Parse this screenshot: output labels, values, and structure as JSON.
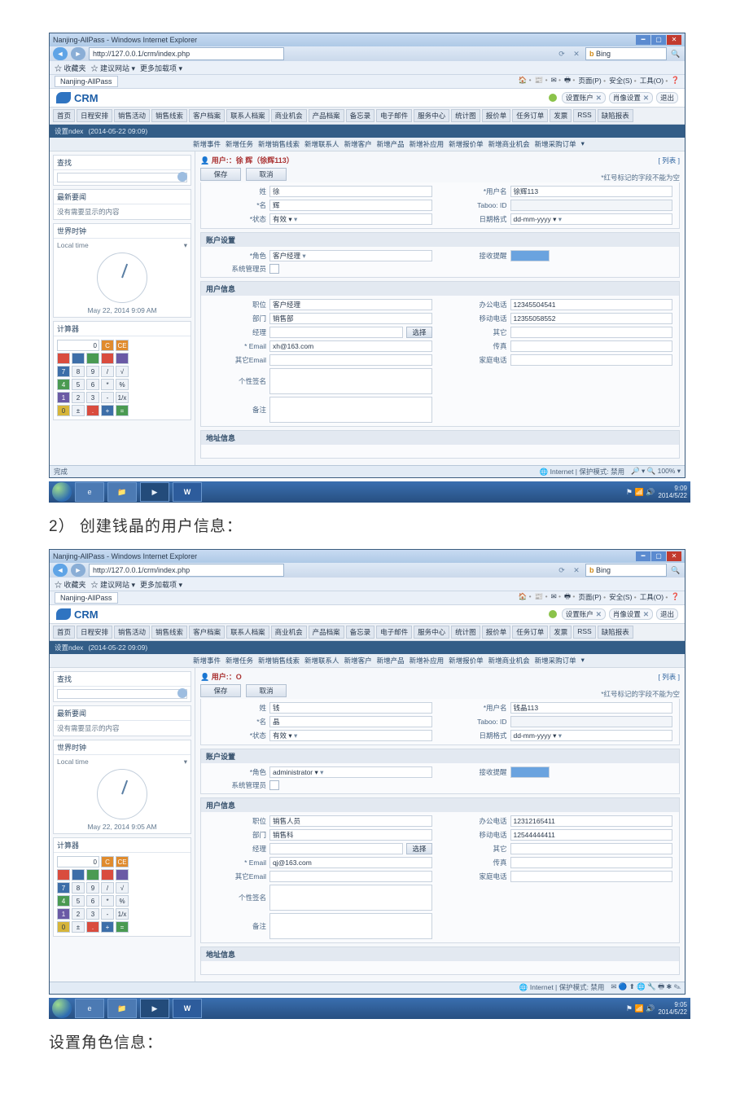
{
  "doc": {
    "caption_step2": "2） 创建钱晶的用户信息：",
    "caption_roles": "设置角色信息："
  },
  "chrome": {
    "tab_title": "Nanjing-AllPass - Windows Internet Explorer",
    "url": "http://127.0.0.1/crm/index.php",
    "search_engine": "Bing",
    "search_refresh": "⟳",
    "search_x": "✕",
    "search_glass": "🔍",
    "fav_star": "☆ 收藏夹",
    "fav_sugg": "☆ 建议网站 ▾",
    "fav_more": "更多加载项 ▾",
    "page_tab": "Nanjing-AllPass",
    "cmd_home": "🏠",
    "cmd_feed": "📰",
    "cmd_mail": "✉",
    "cmd_print": "🖶",
    "cmd_page": "页面(P)",
    "cmd_safe": "安全(S)",
    "cmd_tool": "工具(O)",
    "cmd_help": "❓",
    "status_done": "完成",
    "status_zone": "🌐 Internet | 保护模式: 禁用",
    "status_zoom": "🔎 ▾ 🔍 100% ▾"
  },
  "app": {
    "brand": "CRM",
    "hdr_set1": "设置账户",
    "hdr_set2": "肖像设置",
    "hdr_logout": "退出",
    "modules": [
      "首页",
      "日程安排",
      "销售活动",
      "销售线索",
      "客户档案",
      "联系人档案",
      "商业机会",
      "产品档案",
      "备忘录",
      "电子邮件",
      "服务中心",
      "统计图",
      "报价单",
      "任务订单",
      "发票",
      "RSS",
      "缺陷报表"
    ],
    "subnav_prefix": "设置ndex",
    "subnav_time": "(2014-05-22 09:09)",
    "sub_actions": [
      "新增事件",
      "新增任务",
      "新增销售线索",
      "新增联系人",
      "新增客户",
      "新增产品",
      "新增补应用",
      "新增报价单",
      "新增商业机会",
      "新增采购订单",
      "▾"
    ],
    "left_search_t": "查找",
    "left_news_t": "最新要闻",
    "left_news_b": "没有需要显示的内容",
    "left_clock_t": "世界时钟",
    "left_tz1": "Local time",
    "left_tz2": "▾",
    "left_calc_t": "计算器",
    "clock_date1": "May 22, 2014 9:09 AM",
    "clock_date2": "May 22, 2014 9:05 AM",
    "calc_lcd": "0",
    "save_btn": "保存",
    "cancel_btn": "取消",
    "select_btn": "选择",
    "more_link": "[ 列表 ]",
    "req_note": "*红号标记的字段不能为空",
    "panel_login": "账户设置",
    "panel_role_label": "*角色",
    "panel_sys_label": "系统管理员",
    "panel_badge_label": "接收提醒",
    "panel_info": "用户信息",
    "panel_head_label": "职位",
    "panel_dept_label": "部门",
    "panel_mgr_label": "经理",
    "panel_office_label": "办公电话",
    "panel_mobile_label": "移动电话",
    "panel_other_label": "其它",
    "panel_fax_label": "传真",
    "panel_email_label": "* Email",
    "panel_email2_label": "其它Email",
    "panel_sign_label": "个性签名",
    "panel_home_phone": "家庭电话",
    "panel_remark_label": "备注",
    "panel_addr": "地址信息",
    "f_last": "姓",
    "f_first": "*名",
    "f_status": "*状态",
    "f_status_val": "有效 ▾",
    "f_uname": "*用户名",
    "f_taboo": "Taboo: ID",
    "f_datefmt": "日期格式",
    "f_datefmt_val": "dd-mm-yyyy ▾"
  },
  "user1": {
    "title_line": "用户:：徐 辉（徐辉113）",
    "last": "徐",
    "first": "辉",
    "uname": "徐辉113",
    "role": "客户经理",
    "head": "客户经理",
    "dept": "销售部",
    "email": "xh@163.com",
    "office": "12345504541",
    "mobile": "12355058552"
  },
  "user2": {
    "title_line": "用户:：O",
    "last": "钱",
    "first": "晶",
    "uname": "钱晶113",
    "role": "administrator ▾",
    "head": "销售人员",
    "dept": "销售科",
    "email": "qj@163.com",
    "office": "12312165411",
    "mobile": "12544444411"
  },
  "taskbar": {
    "ie": "e",
    "explorer": "📁",
    "media": "▶",
    "word": "W",
    "tray": "⚑ 📶 🔊",
    "tray_ext": "✉ 🔵 ⬆ 🌐 🔧 🖶 ✱ ✎",
    "clock1_a": "9:09",
    "clock1_b": "2014/5/22",
    "clock2_a": "9:05",
    "clock2_b": "2014/5/22"
  }
}
